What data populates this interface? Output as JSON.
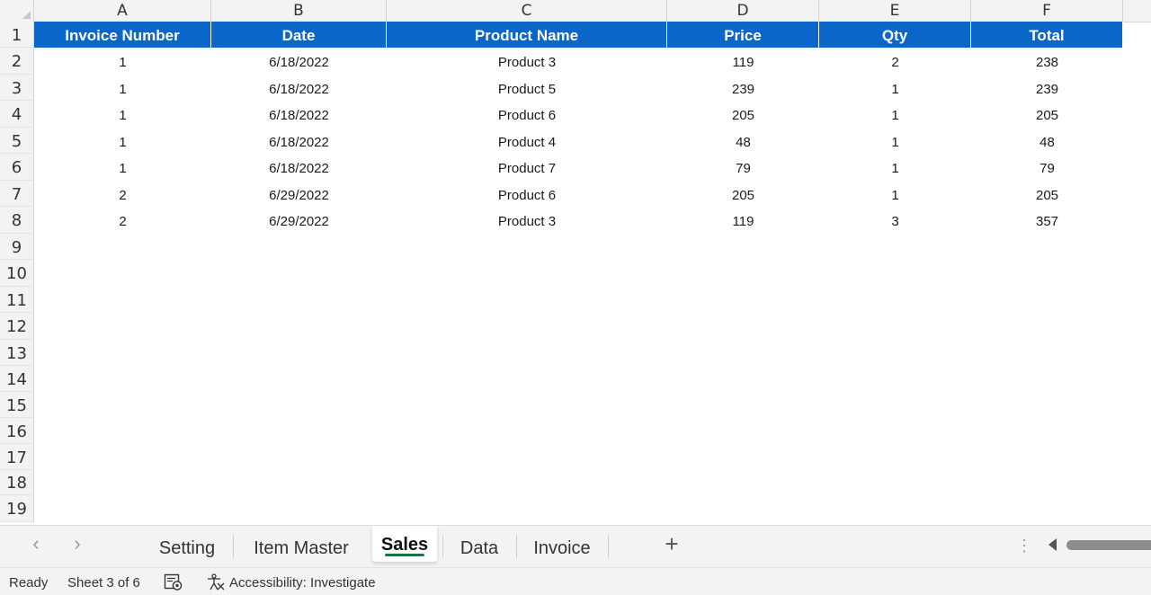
{
  "columns": [
    "A",
    "B",
    "C",
    "D",
    "E",
    "F"
  ],
  "rows": [
    "1",
    "2",
    "3",
    "4",
    "5",
    "6",
    "7",
    "8",
    "9",
    "10",
    "11",
    "12",
    "13",
    "14",
    "15",
    "16",
    "17",
    "18",
    "19"
  ],
  "table": {
    "headers": [
      "Invoice Number",
      "Date",
      "Product Name",
      "Price",
      "Qty",
      "Total"
    ],
    "data": [
      [
        "1",
        "6/18/2022",
        "Product 3",
        "119",
        "2",
        "238"
      ],
      [
        "1",
        "6/18/2022",
        "Product 5",
        "239",
        "1",
        "239"
      ],
      [
        "1",
        "6/18/2022",
        "Product 6",
        "205",
        "1",
        "205"
      ],
      [
        "1",
        "6/18/2022",
        "Product 4",
        "48",
        "1",
        "48"
      ],
      [
        "1",
        "6/18/2022",
        "Product 7",
        "79",
        "1",
        "79"
      ],
      [
        "2",
        "6/29/2022",
        "Product 6",
        "205",
        "1",
        "205"
      ],
      [
        "2",
        "6/29/2022",
        "Product 3",
        "119",
        "3",
        "357"
      ]
    ]
  },
  "header_color": "#0a66c9",
  "sheet_tabs": [
    {
      "label": "Setting",
      "active": false
    },
    {
      "label": "Item Master",
      "active": false
    },
    {
      "label": "Sales",
      "active": true
    },
    {
      "label": "Data",
      "active": false
    },
    {
      "label": "Invoice",
      "active": false
    }
  ],
  "nav": {
    "prev_icon": "chevron-left-icon",
    "next_icon": "chevron-right-icon",
    "add_icon": "plus-icon"
  },
  "status": {
    "ready": "Ready",
    "sheet": "Sheet 3 of 6",
    "accessibility": "Accessibility: Investigate"
  }
}
